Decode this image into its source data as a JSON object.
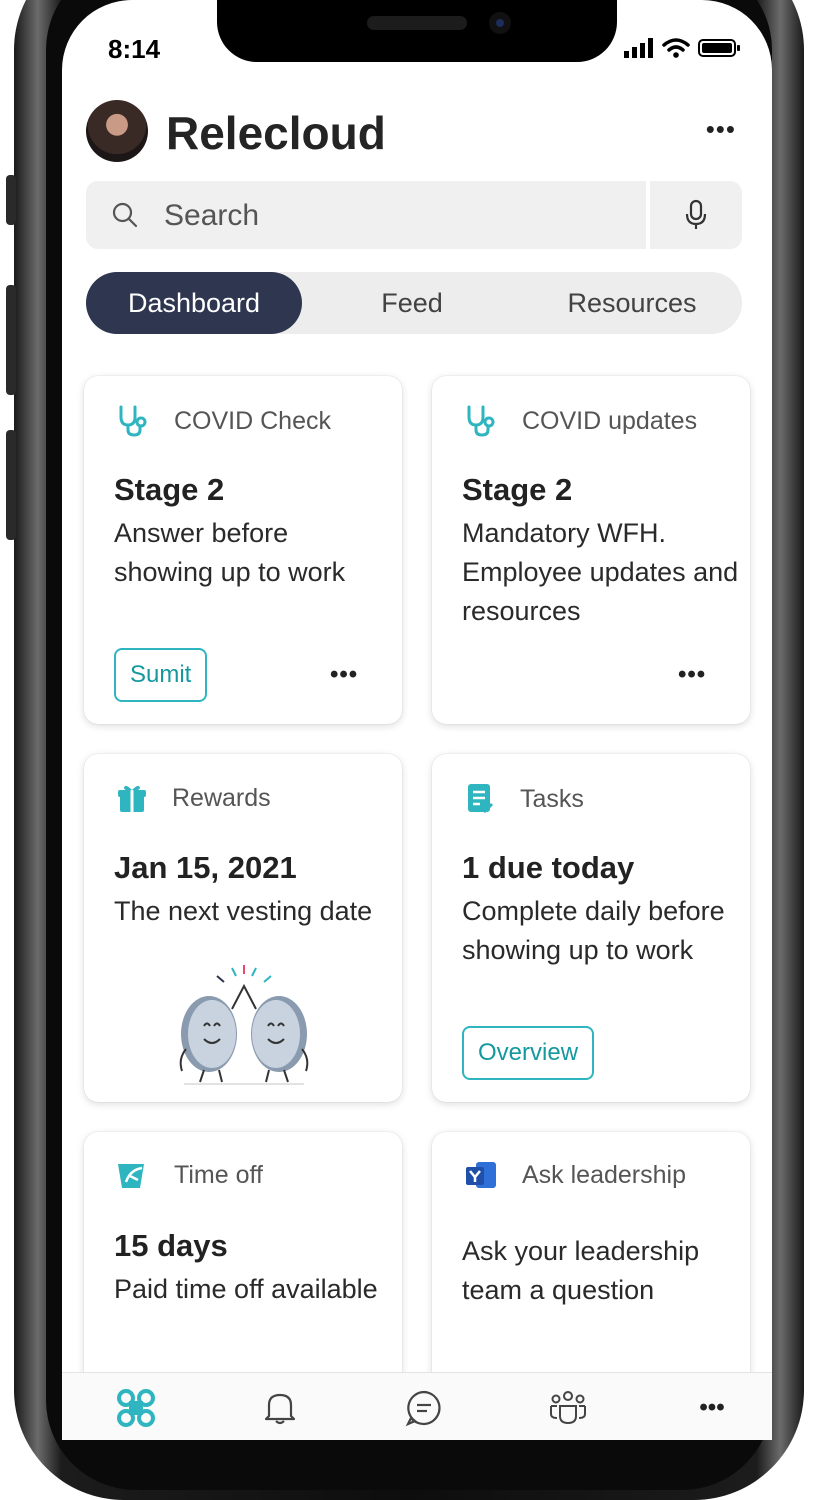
{
  "status_bar": {
    "time": "8:14"
  },
  "header": {
    "title": "Relecloud",
    "more_label": "•••"
  },
  "search": {
    "placeholder": "Search"
  },
  "tabs": [
    {
      "label": "Dashboard",
      "active": true
    },
    {
      "label": "Feed",
      "active": false
    },
    {
      "label": "Resources",
      "active": false
    }
  ],
  "cards": {
    "covid_check": {
      "label": "COVID Check",
      "title": "Stage 2",
      "body": "Answer before showing up to work",
      "button": "Sumit",
      "more": "•••"
    },
    "covid_updates": {
      "label": "COVID updates",
      "title": "Stage 2",
      "body": "Mandatory WFH. Employee updates and resources",
      "more": "•••"
    },
    "rewards": {
      "label": "Rewards",
      "title": "Jan 15, 2021",
      "body": "The next vesting date"
    },
    "tasks": {
      "label": "Tasks",
      "title": "1 due today",
      "body": "Complete daily before showing up to work",
      "button": "Overview"
    },
    "time_off": {
      "label": "Time off",
      "title": "15 days",
      "body": "Paid time off available"
    },
    "ask_leadership": {
      "label": "Ask leadership",
      "body": "Ask your leadership team a question"
    }
  },
  "bottom_nav": {
    "items": [
      "apps-icon",
      "bell-icon",
      "chat-icon",
      "people-icon"
    ],
    "more_label": "•••"
  },
  "colors": {
    "accent": "#2fb5bf",
    "tab_active": "#2e3650"
  }
}
